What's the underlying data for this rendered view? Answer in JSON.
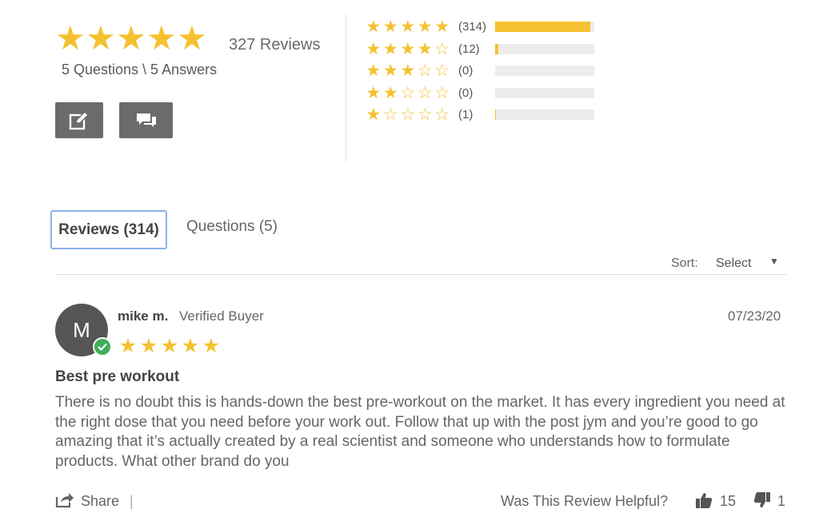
{
  "summary": {
    "average_rating": 5,
    "total_reviews_label": "327 Reviews",
    "qa_label": "5 Questions \\ 5 Answers",
    "write_review_icon": "edit-icon",
    "ask_question_icon": "chat-bubbles-icon"
  },
  "histogram": [
    {
      "stars": 5,
      "count_label": "(314)",
      "fraction": 0.96
    },
    {
      "stars": 4,
      "count_label": "(12)",
      "fraction": 0.03
    },
    {
      "stars": 3,
      "count_label": "(0)",
      "fraction": 0
    },
    {
      "stars": 2,
      "count_label": "(0)",
      "fraction": 0
    },
    {
      "stars": 1,
      "count_label": "(1)",
      "fraction": 0.01
    }
  ],
  "tabs": {
    "reviews_label": "Reviews (314)",
    "questions_label": "Questions (5)"
  },
  "sort": {
    "label": "Sort:",
    "selected": "Select"
  },
  "review": {
    "avatar_initial": "M",
    "name": "mike m.",
    "badge": "Verified Buyer",
    "date": "07/23/20",
    "rating": 5,
    "title": "Best pre workout",
    "body": "There is no doubt this is hands-down the best pre-workout on the market. It has every ingredient you need at the right dose that you need before your work out. Follow that up with the post jym and you’re good to go amazing that it’s actually created by a real scientist and someone who understands how to formulate products. What other brand do you",
    "share_label": "Share",
    "share_separator": "|",
    "helpful_label": "Was This Review Helpful?",
    "helpful_up": "15",
    "helpful_down": "1"
  },
  "colors": {
    "star": "#f5c130",
    "button_bg": "#6b6b6b",
    "tab_focus": "#8ab0ec",
    "verified": "#3fae5c"
  }
}
